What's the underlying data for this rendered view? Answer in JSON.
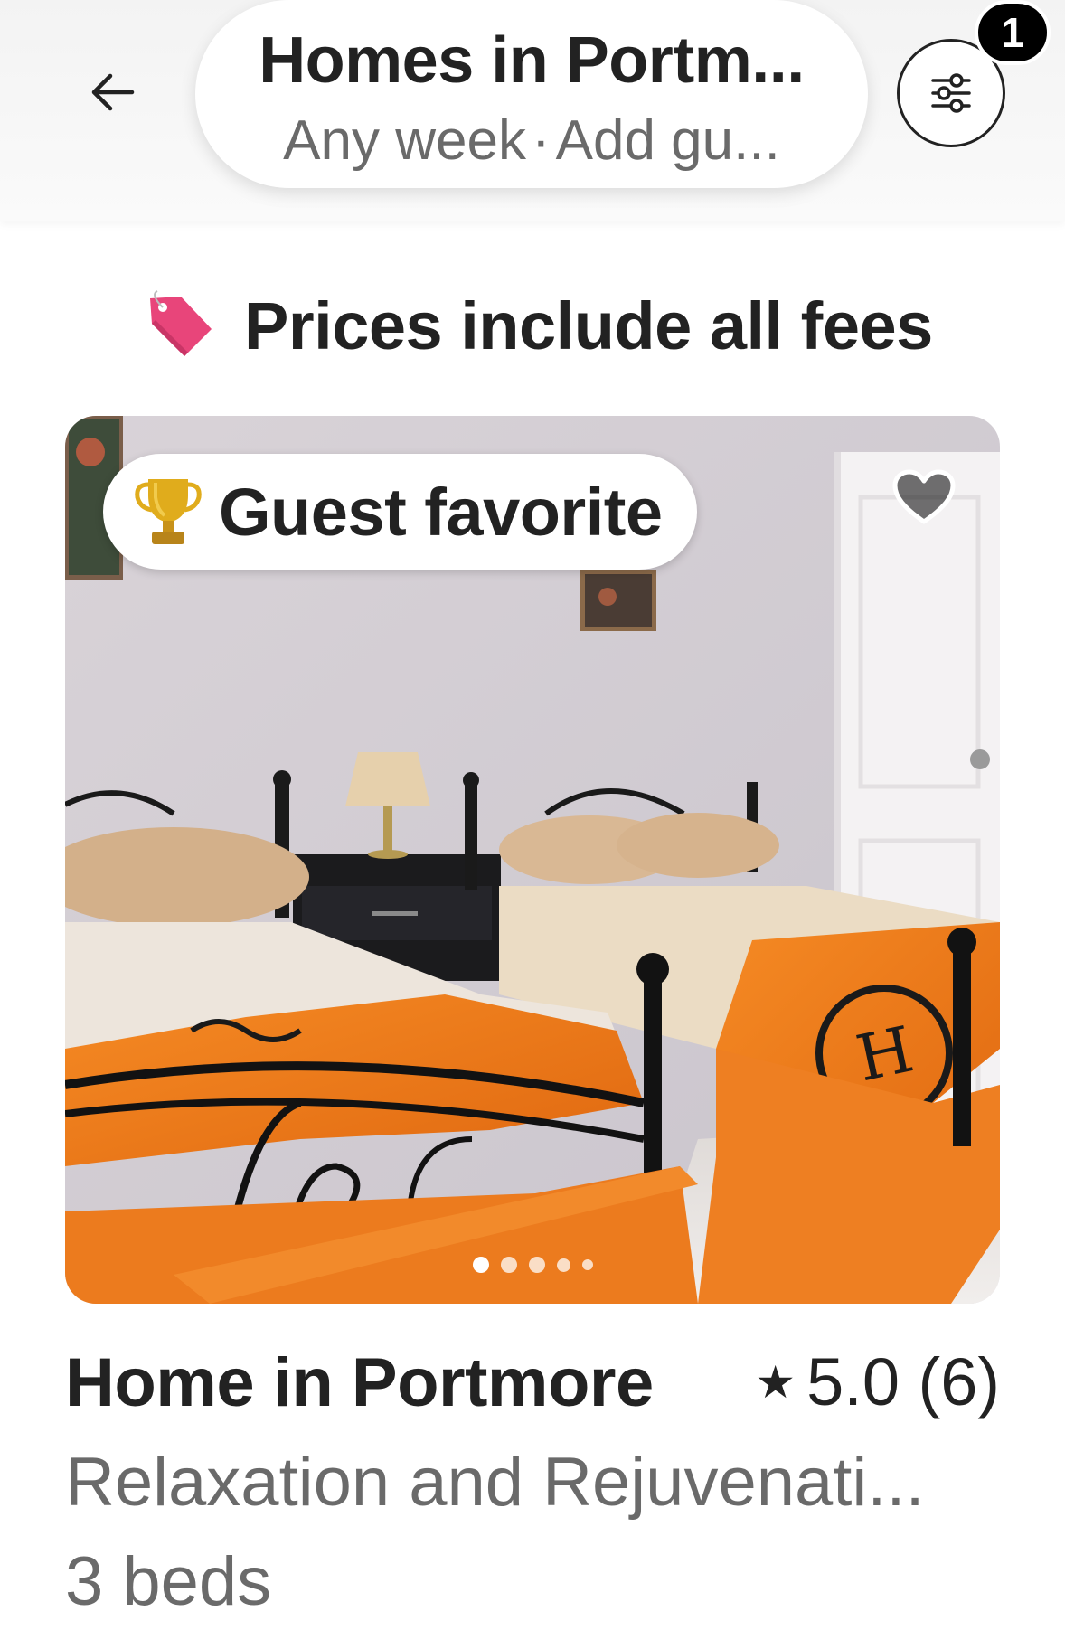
{
  "header": {
    "title": "Homes in Portm...",
    "dates": "Any week",
    "separator": "·",
    "guests": "Add gu...",
    "back_icon": "arrow-left-icon",
    "filter_icon": "sliders-icon",
    "filter_count": "1"
  },
  "notice": {
    "icon": "price-tag-icon",
    "text": "Prices include all fees"
  },
  "listing": {
    "badge_icon": "trophy-icon",
    "badge": "Guest favorite",
    "wishlist_icon": "heart-icon",
    "photo_count": 5,
    "active_photo": 1,
    "title": "Home in Portmore",
    "rating_icon": "star-icon",
    "rating": "5.0 (6)",
    "description": "Relaxation and Rejuvenati...",
    "beds": "3 beds"
  },
  "colors": {
    "text_primary": "#222222",
    "text_secondary": "#6a6a6a",
    "tag_pink": "#e8457a",
    "trophy_gold": "#d4a017",
    "blanket_orange": "#f07a1a"
  }
}
